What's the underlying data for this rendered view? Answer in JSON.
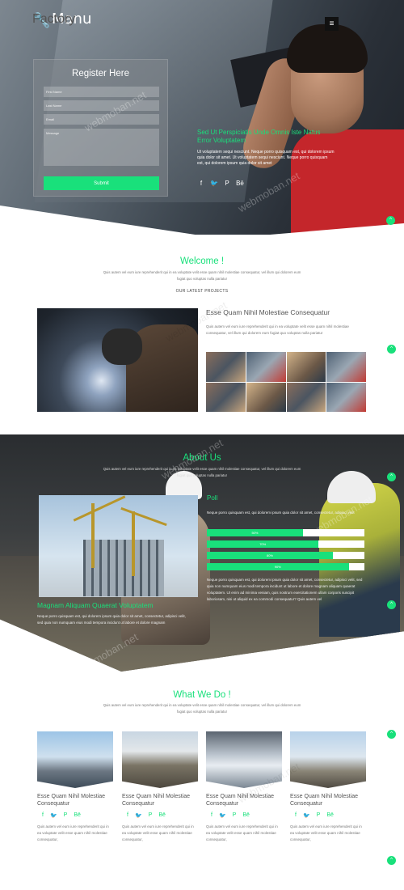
{
  "brand": {
    "title": "Manu",
    "subtitle": "Factory"
  },
  "menu_icon": "menu-icon",
  "register": {
    "heading": "Register Here",
    "fields": [
      "First Name",
      "Last Name",
      "Email"
    ],
    "message_placeholder": "Message",
    "submit": "Submit"
  },
  "hero": {
    "heading": "Sed Ut Perspiciatis Unde Omnis Iste Natus Error Voluptatem",
    "text": "Ut voluptatem sequi nesciunt. Neque porro quisquam est, qui dolorem ipsum quia dolor sit amet. Ut voluptatem sequi nesciunt. Neque porro quisquam est, qui dolorem ipsum quia dolor sit amet",
    "social_icons": [
      "facebook-icon",
      "twitter-icon",
      "pinterest-icon",
      "behance-icon"
    ],
    "social_glyphs": [
      "f",
      "🐦",
      "P",
      "Bē"
    ]
  },
  "welcome": {
    "title": "Welcome !",
    "desc": "Quis autem vel eum iure reprehenderit qui in ea voluptate velit esse quam nihil molestiae consequatur, vel illum qui dolorem eum fugiat quo voluptas nulla pariatur",
    "label": "OUR LATEST PROJECTS",
    "project_title": "Esse Quam Nihil Molestiae Consequatur",
    "project_text": "Quis autem vel eum iure reprehenderit qui in ea voluptate velit esse quam nihil molestiae consequatur, vel illum qui dolorem eum fugiat quo voluptas nulla pariatur"
  },
  "about": {
    "title": "About Us",
    "desc": "Quis autem vel eum iure reprehenderit qui in ea voluptate velit esse quam nihil molestiae consequatur, vel illum qui dolorem eum fugiat quo voluptas nulla pariatur",
    "poll_title": "Poll",
    "poll_text": "Neque porro quisquam est, qui dolorem ipsum quia dolor sit amet, consectetur, adipisci velit",
    "bars": [
      {
        "label": "50%",
        "value": 50
      },
      {
        "label": "70%",
        "value": 70
      },
      {
        "label": "80%",
        "value": 80
      },
      {
        "label": "90%",
        "value": 90
      }
    ],
    "text2": "Neque porro quisquam est, qui dolorem ipsum quia dolor sit amet, consectetur, adipisci velit, sed quia non numquam eius modi tempora incidunt ut labore et dolore magnam aliquam quaerat voluptatem. Ut enim ad minima veniam, quis nostrum exercitationem ullam corporis suscipit laboriosam, nisi ut aliquid ex ea commodi consequatur? Quis autem vel",
    "heading2": "Magnam Aliquam Quaerat Voluptatem",
    "text3": "Neque porro quisquam est, qui dolorem ipsum quia dolor sit amet, consectetur, adipisci velit, sed quia non numquam eius modi tempora incidunt ut labore et dolore magnam"
  },
  "services": {
    "title": "What We Do !",
    "desc": "Quis autem vel eum iure reprehenderit qui in ea voluptate velit esse quam nihil molestiae consequatur, vel illum qui dolorem eum fugiat quo voluptas nulla pariatur",
    "cards": [
      {
        "title": "Esse Quam Nihil Molestiae Consequatur",
        "text": "Quis autem vel eum iure reprehenderit qui in ea voluptate velit esse quam nihil molestiae consequatur,"
      },
      {
        "title": "Esse Quam Nihil Molestiae Consequatur",
        "text": "Quis autem vel eum iure reprehenderit qui in ea voluptate velit esse quam nihil molestiae consequatur,"
      },
      {
        "title": "Esse Quam Nihil Molestiae Consequatur",
        "text": "Quis autem vel eum iure reprehenderit qui in ea voluptate velit esse quam nihil molestiae consequatur,"
      },
      {
        "title": "Esse Quam Nihil Molestiae Consequatur",
        "text": "Quis autem vel eum iure reprehenderit qui in ea voluptate velit esse quam nihil molestiae consequatur,"
      }
    ],
    "card_icons": [
      "f",
      "🐦",
      "P",
      "Bē"
    ]
  },
  "up_icon": "^",
  "watermark": "webmoban.net",
  "colors": {
    "accent": "#19e07b"
  }
}
